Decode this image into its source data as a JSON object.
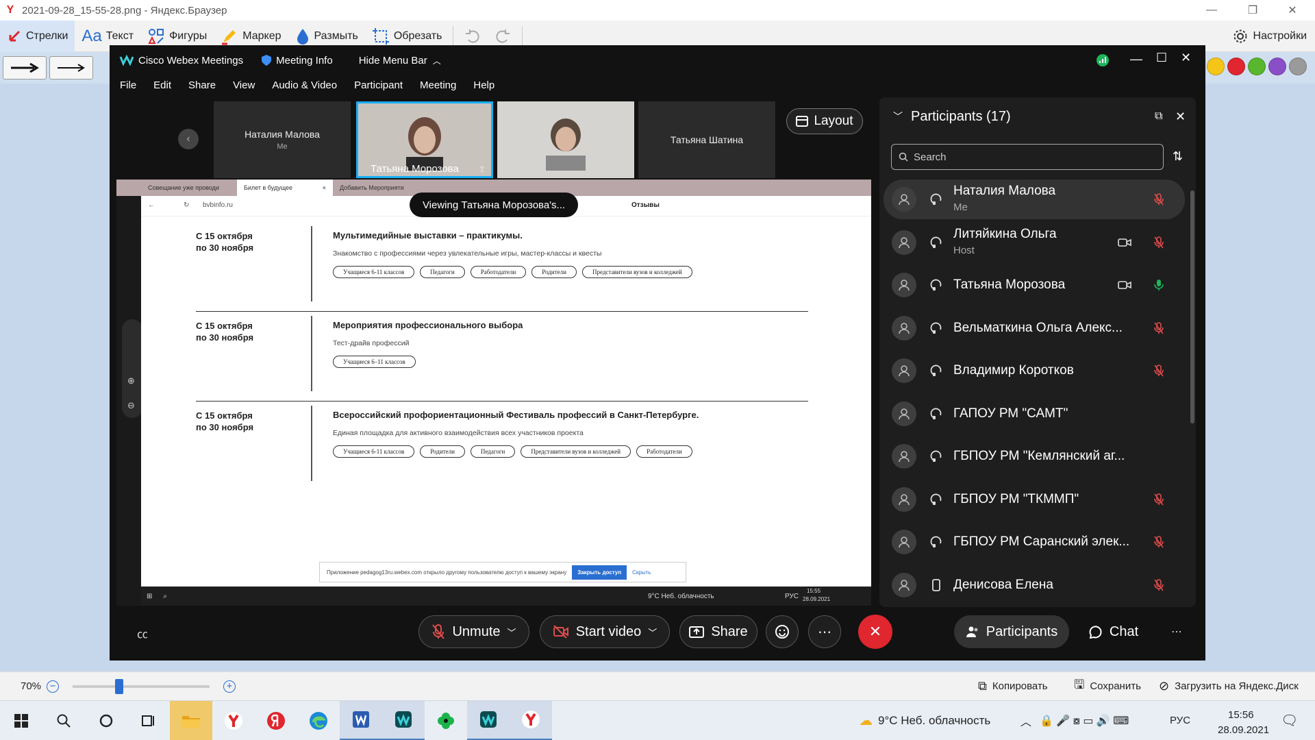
{
  "viewer": {
    "title": "2021-09-28_15-55-28.png - Яндекс.Браузер",
    "tools": [
      "Стрелки",
      "Текст",
      "Фигуры",
      "Маркер",
      "Размыть",
      "Обрезать"
    ],
    "settings": "Настройки",
    "zoom": "70%",
    "actions": [
      "Копировать",
      "Сохранить",
      "Загрузить на Яндекс.Диск"
    ],
    "palette": [
      "#f5c518",
      "#e0262e",
      "#58b62f",
      "#8a4fc6",
      "#9a9a9a"
    ]
  },
  "webex": {
    "app_title": "Cisco Webex Meetings",
    "meeting_info": "Meeting Info",
    "hide_menu": "Hide Menu Bar",
    "menu": [
      "File",
      "Edit",
      "Share",
      "View",
      "Audio & Video",
      "Participant",
      "Meeting",
      "Help"
    ],
    "thumbs": [
      {
        "name": "Наталия Малова",
        "sub": "Me"
      },
      {
        "name": "Татьяна Морозова",
        "sub": ""
      },
      {
        "name": "",
        "sub": ""
      },
      {
        "name": "Татьяна Шатина",
        "sub": ""
      }
    ],
    "layout": "Layout",
    "viewing": "Viewing Татьяна Морозова's...",
    "controls": {
      "unmute": "Unmute",
      "start_video": "Start video",
      "share": "Share",
      "participants": "Participants",
      "chat": "Chat"
    }
  },
  "shared": {
    "tabs": [
      "Совещание уже проводи",
      "Билет в будущее",
      "Добавить Мероприяти"
    ],
    "address": "bvbinfo.ru",
    "feedback": "Отзывы",
    "events": [
      {
        "date": [
          "С 15 октября",
          "по 30 ноября"
        ],
        "title": "Мультимедийные выставки – практикумы.",
        "desc": "Знакомство с профессиями через увлекательные игры, мастер-классы и квесты",
        "tags": [
          "Учащиеся 6-11 классов",
          "Педагоги",
          "Работодатели",
          "Родители",
          "Представители вузов и колледжей"
        ]
      },
      {
        "date": [
          "С 15 октября",
          "по 30 ноября"
        ],
        "title": "Мероприятия профессионального выбора",
        "desc": "Тест-драйв профессий",
        "tags": [
          "Учащиеся 6–11 классов"
        ]
      },
      {
        "date": [
          "С 15 октября",
          "по 30 ноября"
        ],
        "title": "Всероссийский профориентационный Фестиваль профессий в Санкт-Петербурге.",
        "desc": "Единая площадка для активного взаимодействия всех участников проекта",
        "tags": [
          "Учащиеся 6-11 классов",
          "Родители",
          "Педагоги",
          "Представители вузов и колледжей",
          "Работодатели"
        ]
      }
    ],
    "notice": {
      "text": "Приложение pedagog13ru.webex.com открыло другому пользователю доступ к вашему экрану",
      "button": "Закрыть доступ",
      "hide": "Скрыть"
    },
    "taskbar": {
      "weather": "9°C  Неб. облачность",
      "lang": "РУС",
      "time": "15:55",
      "date": "28.09.2021"
    }
  },
  "participants": {
    "title": "Participants (17)",
    "search_placeholder": "Search",
    "list": [
      {
        "name": "Наталия Малова",
        "role": "Me",
        "video": false,
        "mic": "muted",
        "selected": true,
        "phone": false
      },
      {
        "name": "Литяйкина Ольга",
        "role": "Host",
        "video": true,
        "mic": "muted",
        "selected": false,
        "phone": false
      },
      {
        "name": "Татьяна Морозова",
        "role": "",
        "video": true,
        "mic": "on",
        "selected": false,
        "phone": false
      },
      {
        "name": "Вельматкина Ольга Алекс...",
        "role": "",
        "video": false,
        "mic": "muted",
        "selected": false,
        "phone": false
      },
      {
        "name": "Владимир Коротков",
        "role": "",
        "video": false,
        "mic": "muted",
        "selected": false,
        "phone": false
      },
      {
        "name": "ГАПОУ РМ \"САМТ\"",
        "role": "",
        "video": false,
        "mic": "none",
        "selected": false,
        "phone": false
      },
      {
        "name": "ГБПОУ РМ \"Кемлянский аг...",
        "role": "",
        "video": false,
        "mic": "none",
        "selected": false,
        "phone": false
      },
      {
        "name": "ГБПОУ РМ \"ТКММП\"",
        "role": "",
        "video": false,
        "mic": "muted",
        "selected": false,
        "phone": false
      },
      {
        "name": "ГБПОУ РМ Саранский элек...",
        "role": "",
        "video": false,
        "mic": "muted",
        "selected": false,
        "phone": false
      },
      {
        "name": "Денисова Елена",
        "role": "",
        "video": false,
        "mic": "muted",
        "selected": false,
        "phone": true
      }
    ]
  },
  "os_taskbar": {
    "weather": "9°C  Неб. облачность",
    "lang": "РУС",
    "time": "15:56",
    "date": "28.09.2021"
  }
}
